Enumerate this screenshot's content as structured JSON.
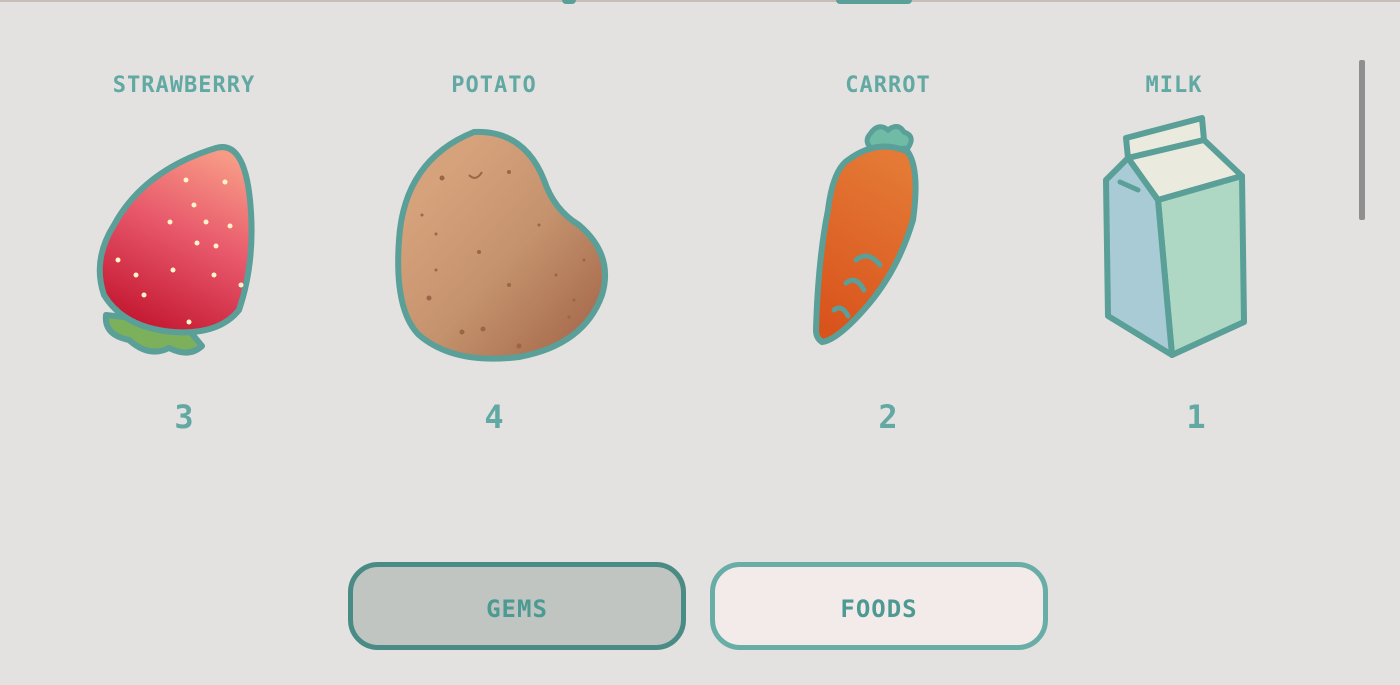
{
  "items": [
    {
      "name": "STRAWBERRY",
      "count": "3",
      "icon": "strawberry-icon"
    },
    {
      "name": "POTATO",
      "count": "4",
      "icon": "potato-icon"
    },
    {
      "name": "CARROT",
      "count": "2",
      "icon": "carrot-icon"
    },
    {
      "name": "MILK",
      "count": "1",
      "icon": "milk-carton-icon"
    }
  ],
  "tabs": {
    "gems_label": "GEMS",
    "foods_label": "FOODS",
    "active": "gems"
  },
  "colors": {
    "background": "#e3e2e0",
    "accent_teal": "#62a8a3",
    "button_dark": "#c0c5c1",
    "button_light": "#f2ebea"
  }
}
